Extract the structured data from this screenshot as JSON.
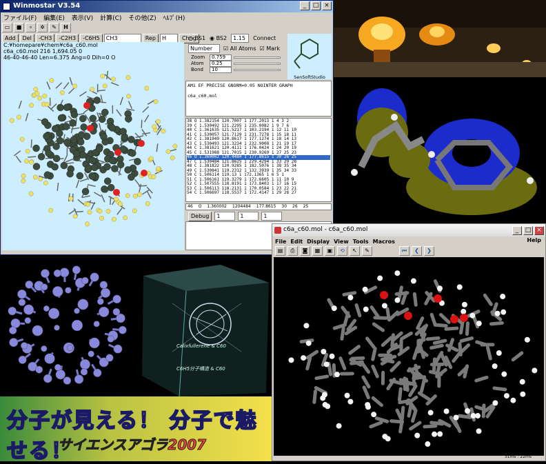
{
  "winmostar": {
    "title": "Winmostar V3.54",
    "menu": [
      "ファイル(F)",
      "編集(E)",
      "表示(V)",
      "計算(C)",
      "その他(Z)",
      "ﾍﾙﾌﾟ(H)"
    ],
    "toolbar_btns": [
      "Add",
      "Del",
      "-CH3",
      "-C2H3",
      "-C6H5",
      "CH3",
      "Rep",
      "H",
      "Chng"
    ],
    "info_lines": [
      "C:¥homepare¥chem¥c6a_c60.mol",
      "c6a_c60.mol  216  1,694.05  0",
      "46-40-46-40 Len=6.375 Ang=0 Dih=0 O"
    ],
    "bs1": "BS1",
    "bs2": "BS2",
    "connect_val": "1.15",
    "connect_label": "Connect",
    "number_label": "Number",
    "all_atoms": "All Atoms",
    "mark": "Mark",
    "zoom_label": "Zoom",
    "zoom_val": "0.759",
    "atom_label": "Atom",
    "atom_val": "0.25",
    "bond_label": "Bond",
    "bond_val": "10",
    "sensoft": "SenSoftStudio",
    "keywords": "AM1 EF PRECISE GNORM=0.05 NOINTER GRAPH",
    "filename": "c6a_c60.mol",
    "table_rows": [
      "38  O  1.382154  120.7007 1  177.2013 1   4   3   2",
      "39  C  1.530492  121.2295 1  235.0082 1   9   7   6",
      "40  C  1.361635  121.5217 1  103.2194 1  12  11  10",
      "41  C  1.530057  121.7129 1  231.7278 1  15  18  11",
      "42  C  1.381949  120.8617 1  177.1274 1  18  14  13",
      "43  C  1.530493  121.3234 1  232.9008 1  21  19  17",
      "44  C  1.381621  120.4111 1  176.0424 1  24  20  19",
      "45  C  1.531988  121.7015 1  230.9269 1  27  25  23",
      "46  O  1.360002  120.4484 1  177.8615 1  30  26  25",
      "47  C  1.530484  121.8625 1  229.4294 1  33  29  28",
      "48  C  1.381822  120.9285 1  182.5076 1  38  35  34",
      "49  C  1.530841  119.2312 1  132.3939 1  35  34  33",
      "50  C  1.506114  119.13   1  172.1365 1   6   5   1",
      "51  C  1.506161  119.3279 1  172.6605 1  11  10   9",
      "52  C  1.507555  118.8191 1  173.8403 1  17  16  15",
      "53  C  1.506113  118.2131 1  170.0584 1  23  22  21",
      "54  C  1.506697  118.5537 1  172.4147 1  29  28  27"
    ],
    "edit_row": [
      "46",
      "O",
      "1.360002",
      "1204484",
      "177.8615",
      "30",
      "26",
      "25"
    ],
    "debug": "Debug",
    "dd1": "1",
    "dd2": "1",
    "dd3": "1"
  },
  "jmol": {
    "title": "c6a_c60.mol - c6a_c60.mol",
    "menu": [
      "File",
      "Edit",
      "Display",
      "View",
      "Tools",
      "Macros"
    ],
    "help": "Help",
    "status": "31ms : 22ms"
  },
  "banner": {
    "line1": "分子が見える！ 分子で魅せる！",
    "line2": "サイエンスアゴラ2007"
  },
  "cube_text": [
    "Calixfullerene & C60",
    "C6H5分子構造 & C60"
  ],
  "colors": {
    "winmostar_canvas": "#cceeff",
    "atom_carbon": "#3d4d3d",
    "atom_oxygen": "#dd2222",
    "atom_hydrogen": "#f0e060",
    "jmol_carbon": "#7a7a7a",
    "jmol_oxygen": "#dd1111",
    "buckyball": "#8888dd"
  }
}
